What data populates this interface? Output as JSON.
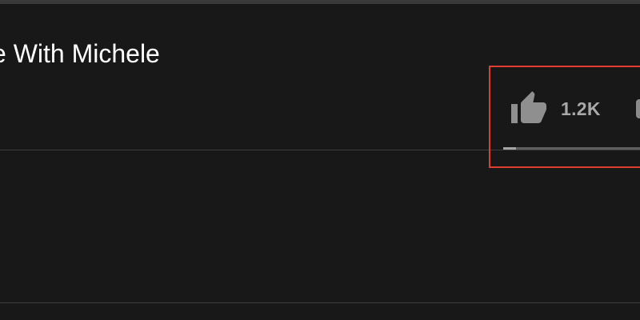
{
  "video": {
    "title_visible": "e With Michele"
  },
  "actions": {
    "like_count": "1.2K",
    "like_icon": "thumb-up-icon",
    "dislike_icon": "thumb-down-icon"
  },
  "sentiment_bar": {
    "like_fraction": 0.09
  },
  "colors": {
    "background": "#181818",
    "title_text": "#ffffff",
    "action_text": "#a8a8a8",
    "highlight": "#e03e2f"
  }
}
